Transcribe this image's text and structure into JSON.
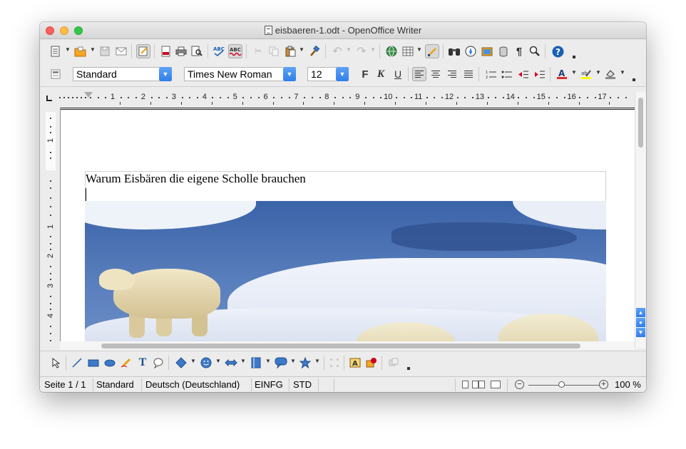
{
  "window": {
    "title": "eisbaeren-1.odt - OpenOffice Writer"
  },
  "format_bar": {
    "paragraph_style": "Standard",
    "font_name": "Times New Roman",
    "font_size": "12",
    "bold_label": "F",
    "italic_label": "K",
    "underline_label": "U"
  },
  "ruler": {
    "marks": [
      "1",
      "2",
      "3",
      "4",
      "5",
      "6",
      "7",
      "8",
      "9",
      "10",
      "11",
      "12",
      "13",
      "14",
      "15",
      "16",
      "17"
    ],
    "vertical_marks": [
      "1",
      "1",
      "2",
      "3",
      "4"
    ]
  },
  "document": {
    "heading": "Warum Eisbären die eigene Scholle brauchen",
    "image": "polar-bear-photo"
  },
  "icons": {
    "toolbar1": [
      "new-doc-icon",
      "open-icon",
      "save-icon",
      "email-icon",
      "edit-mode-icon",
      "pdf-export-icon",
      "print-icon",
      "print-preview-icon",
      "spellcheck-icon",
      "autospellcheck-icon",
      "cut-icon",
      "copy-icon",
      "paste-icon",
      "clone-format-icon",
      "undo-icon",
      "redo-icon",
      "hyperlink-icon",
      "table-icon",
      "show-draw-icon",
      "find-icon",
      "navigator-icon",
      "gallery-icon",
      "datasources-icon",
      "formatting-marks-icon",
      "zoom-icon",
      "help-icon"
    ],
    "toolbar2": [
      "styles-icon",
      "align-left-icon",
      "align-center-icon",
      "align-right-icon",
      "justify-icon",
      "numbering-icon",
      "bullets-icon",
      "decrease-indent-icon",
      "increase-indent-icon",
      "font-color-icon",
      "highlight-icon",
      "background-color-icon"
    ],
    "drawbar": [
      "select-icon",
      "line-icon",
      "rectangle-icon",
      "ellipse-icon",
      "freeform-icon",
      "text-icon",
      "callout-icon",
      "basic-shapes-icon",
      "symbol-shapes-icon",
      "block-arrows-icon",
      "flowchart-icon",
      "callouts-icon",
      "stars-icon",
      "points-icon",
      "fontwork-icon",
      "from-file-icon",
      "extrusion-icon"
    ]
  },
  "status": {
    "page": "Seite 1 / 1",
    "style": "Standard",
    "language": "Deutsch (Deutschland)",
    "insert_mode": "EINFG",
    "selection_mode": "STD",
    "zoom": "100 %"
  },
  "colors": {
    "accent": "#2f7de9",
    "font_color_bar": "#e52c2c",
    "highlight_bar": "#ffff00"
  }
}
